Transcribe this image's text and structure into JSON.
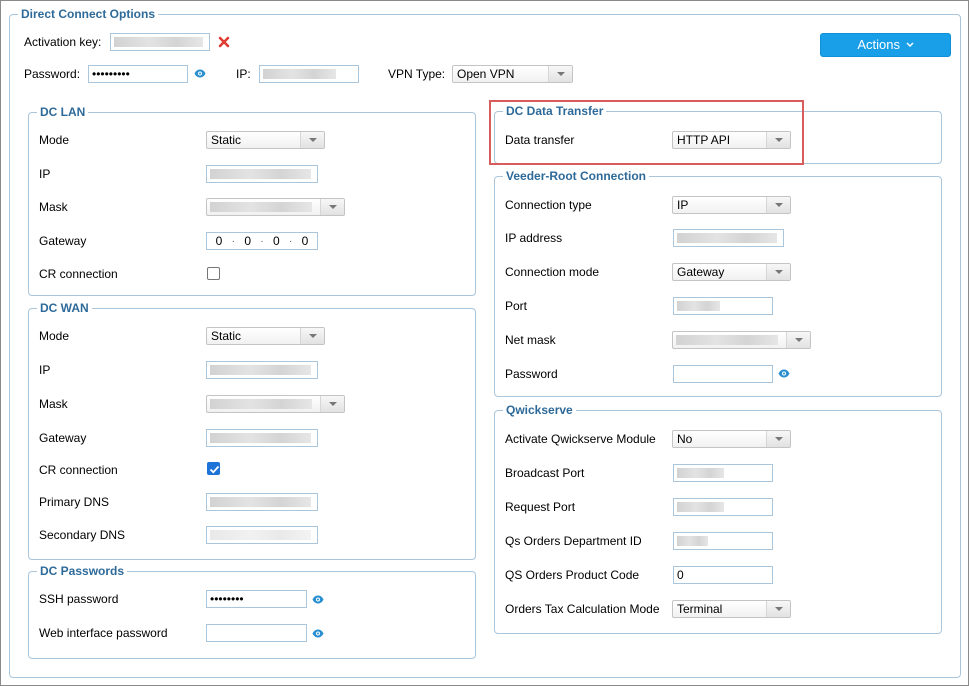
{
  "main": {
    "title": "Direct Connect Options",
    "actions_label": "Actions"
  },
  "top": {
    "activation_key_label": "Activation key:",
    "password_label": "Password:",
    "password_value": "•••••••••",
    "ip_label": "IP:",
    "vpn_type_label": "VPN Type:",
    "vpn_type_value": "Open VPN"
  },
  "dc_lan": {
    "title": "DC LAN",
    "mode_label": "Mode",
    "mode_value": "Static",
    "ip_label": "IP",
    "mask_label": "Mask",
    "gateway_label": "Gateway",
    "gateway_octets": [
      "0",
      "0",
      "0",
      "0"
    ],
    "cr_label": "CR connection",
    "cr_checked": false
  },
  "dc_wan": {
    "title": "DC WAN",
    "mode_label": "Mode",
    "mode_value": "Static",
    "ip_label": "IP",
    "mask_label": "Mask",
    "gateway_label": "Gateway",
    "cr_label": "CR connection",
    "cr_checked": true,
    "primary_dns_label": "Primary DNS",
    "secondary_dns_label": "Secondary DNS"
  },
  "dc_passwords": {
    "title": "DC Passwords",
    "ssh_label": "SSH password",
    "ssh_value": "••••••••",
    "web_label": "Web interface password"
  },
  "dc_data_transfer": {
    "title": "DC Data Transfer",
    "data_transfer_label": "Data transfer",
    "data_transfer_value": "HTTP API"
  },
  "veeder_root": {
    "title": "Veeder-Root Connection",
    "connection_type_label": "Connection type",
    "connection_type_value": "IP",
    "ip_address_label": "IP address",
    "connection_mode_label": "Connection mode",
    "connection_mode_value": "Gateway",
    "port_label": "Port",
    "net_mask_label": "Net mask",
    "password_label": "Password"
  },
  "qwickserve": {
    "title": "Qwickserve",
    "activate_label": "Activate Qwickserve Module",
    "activate_value": "No",
    "broadcast_port_label": "Broadcast Port",
    "request_port_label": "Request Port",
    "qs_dept_label": "Qs Orders Department ID",
    "qs_product_label": "QS Orders Product Code",
    "qs_product_value": "0",
    "tax_mode_label": "Orders Tax Calculation Mode",
    "tax_mode_value": "Terminal"
  },
  "colors": {
    "accent": "#199ee8",
    "legend": "#2e6a99",
    "highlight": "#d95c5c",
    "close_icon": "#e03c31"
  }
}
